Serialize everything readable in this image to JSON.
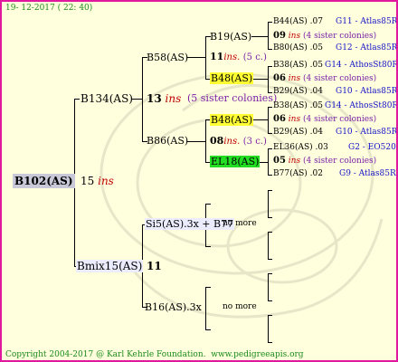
{
  "header": {
    "date": "19- 12-2017 ( 22: 40)"
  },
  "footer": {
    "copyright": "Copyright 2004-2017 @ Karl Kehrle Foundation.",
    "url": "www.pedigreeapis.org"
  },
  "gen1": {
    "name": "B102(AS)",
    "year": "15",
    "ins": "ins"
  },
  "gen2": [
    {
      "name": "B134(AS)",
      "year": "13",
      "ins": "ins",
      "note": "(5 sister colonies)"
    },
    {
      "name": "Bmix15(AS)",
      "year": "11"
    }
  ],
  "gen3": [
    {
      "name": "B58(AS)"
    },
    {
      "name": "B86(AS)"
    },
    {
      "name": "Si5(AS).3x + B77",
      "note": "no more"
    },
    {
      "name": "B16(AS).3x",
      "note": "no more"
    }
  ],
  "gen4": [
    {
      "name": "B19(AS)"
    },
    {
      "name": "11",
      "ins": "ins.",
      "note": "(5 c.)"
    },
    {
      "name": "B48(AS)"
    },
    {
      "name": "B48(AS)"
    },
    {
      "name": "08",
      "ins": "ins.",
      "note": "(3 c.)"
    },
    {
      "name": "EL18(AS)"
    }
  ],
  "gen5": [
    {
      "name": "B44(AS) .07",
      "line": "G11 - Atlas85R"
    },
    {
      "year": "09",
      "ins": "ins",
      "note": "(4 sister colonies)"
    },
    {
      "name": "B80(AS) .05",
      "line": "G12 - Atlas85R"
    },
    {
      "name": "B38(AS) .05",
      "line": "G14 - AthosSt80R"
    },
    {
      "year": "06",
      "ins": "ins",
      "note": "(4 sister colonies)"
    },
    {
      "name": "B29(AS) .04",
      "line": "G10 - Atlas85R"
    },
    {
      "name": "B38(AS) .05",
      "line": "G14 - AthosSt80R"
    },
    {
      "year": "06",
      "ins": "ins",
      "note": "(4 sister colonies)"
    },
    {
      "name": "B29(AS) .04",
      "line": "G10 - Atlas85R"
    },
    {
      "name": "EL36(AS) .03",
      "line": "G2 - EO520"
    },
    {
      "year": "05",
      "ins": "ins",
      "note": "(4 sister colonies)"
    },
    {
      "name": "B77(AS) .02",
      "line": "G9 - Atlas85R"
    }
  ]
}
